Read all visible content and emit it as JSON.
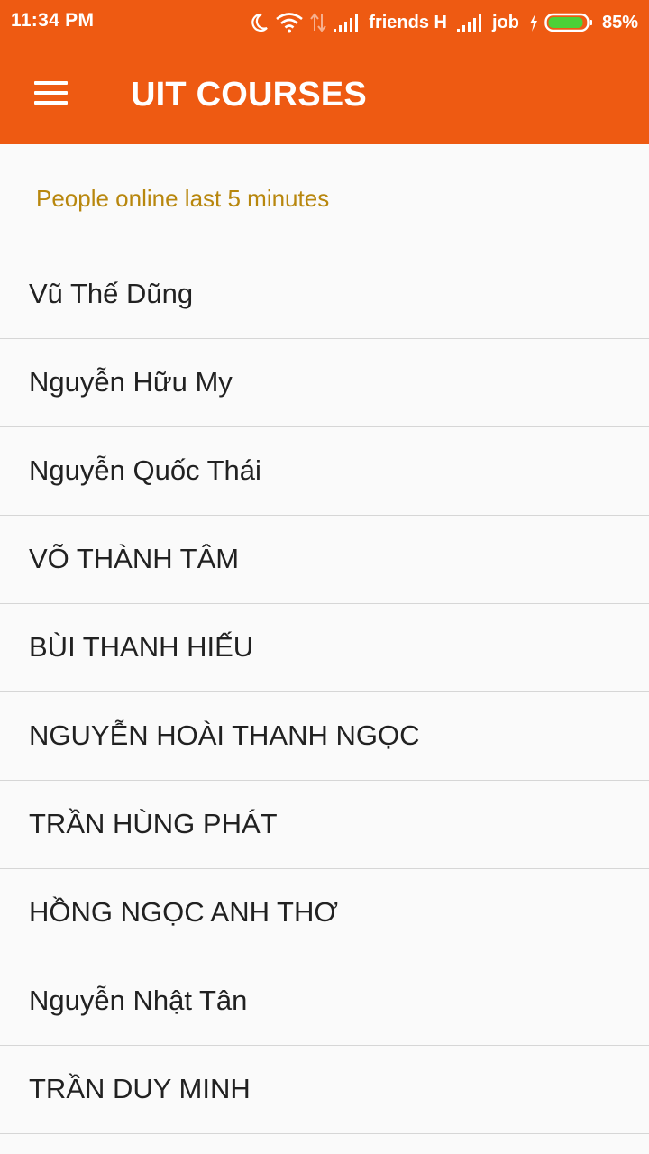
{
  "status_bar": {
    "time": "11:34 PM",
    "carrier_1": "friends H",
    "carrier_2": "job",
    "battery": "85%",
    "icons": [
      "moon-icon",
      "wifi-icon",
      "data-transfer-icon",
      "signal-icon",
      "signal-icon",
      "charging-icon",
      "battery-icon"
    ]
  },
  "app_bar": {
    "title": "UIT COURSES",
    "menu_icon": "hamburger-menu-icon"
  },
  "section": {
    "header": "People online last 5 minutes"
  },
  "people": [
    "Vũ Thế Dũng",
    "Nguyễn Hữu My",
    "Nguyễn Quốc Thái",
    "VÕ THÀNH TÂM",
    "BÙI THANH HIẾU",
    "NGUYỄN HOÀI THANH NGỌC",
    "TRẦN HÙNG PHÁT",
    "HỒNG NGỌC ANH THƠ",
    "Nguyễn Nhật Tân",
    "TRẦN DUY MINH"
  ],
  "colors": {
    "primary": "#ee5a12",
    "section_header": "#b8870e",
    "battery_fill": "#4cd137"
  }
}
